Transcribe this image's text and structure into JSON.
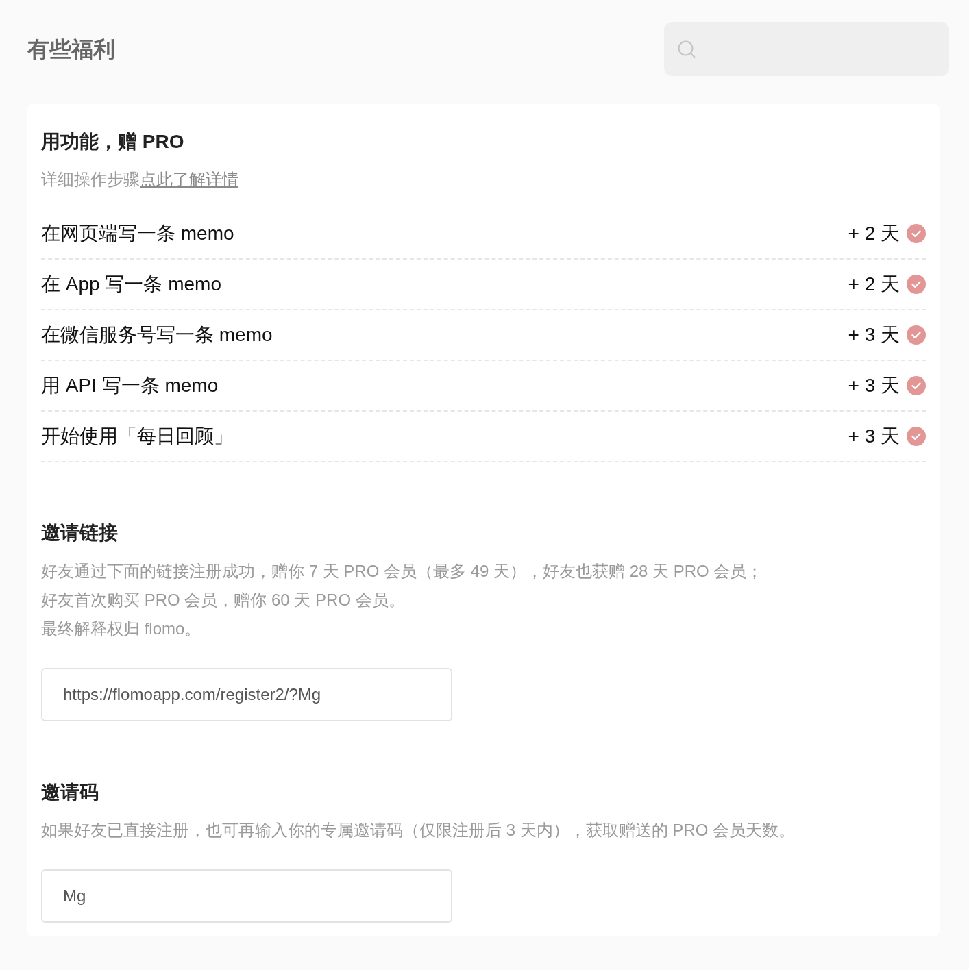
{
  "page_title": "有些福利",
  "tasks_section": {
    "title": "用功能，赠 PRO",
    "subtitle": {
      "text": "详细操作步骤",
      "link": "点此了解详情"
    },
    "tasks": [
      {
        "label": "在网页端写一条 memo",
        "reward": "+ 2 天",
        "done": true
      },
      {
        "label": "在 App 写一条 memo",
        "reward": "+ 2 天",
        "done": true
      },
      {
        "label": "在微信服务号写一条 memo",
        "reward": "+ 3 天",
        "done": true
      },
      {
        "label": "用 API 写一条 memo",
        "reward": "+ 3 天",
        "done": true
      },
      {
        "label": "开始使用「每日回顾」",
        "reward": "+ 3 天",
        "done": true
      }
    ]
  },
  "invite_link_section": {
    "title": "邀请链接",
    "lines": [
      "好友通过下面的链接注册成功，赠你 7 天 PRO 会员（最多 49 天），好友也获赠 28 天 PRO 会员；",
      "好友首次购买 PRO 会员，赠你 60 天 PRO 会员。",
      "最终解释权归 flomo。"
    ],
    "value": "https://flomoapp.com/register2/?Mg"
  },
  "invite_code_section": {
    "title": "邀请码",
    "lines": [
      "如果好友已直接注册，也可再输入你的专属邀请码（仅限注册后 3 天内），获取赠送的 PRO 会员天数。"
    ],
    "value": "Mg"
  }
}
